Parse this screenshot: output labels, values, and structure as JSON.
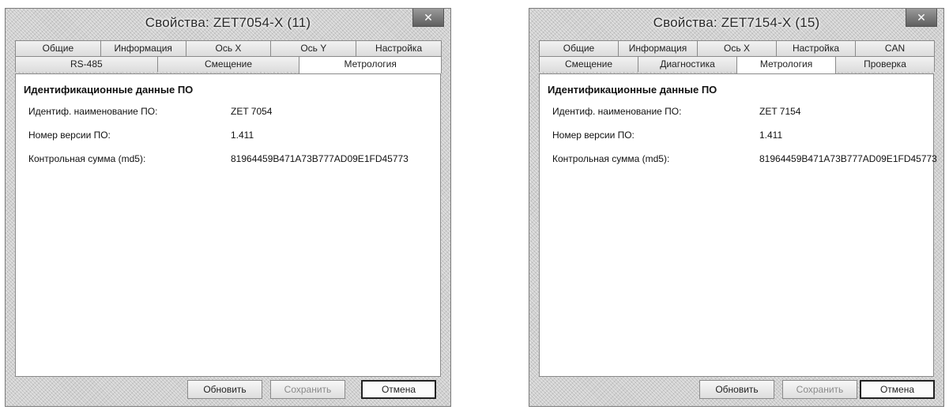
{
  "windows": [
    {
      "title": "Свойства: ZET7054-X (11)",
      "close_label": "✕",
      "tabs_row1": [
        "Общие",
        "Информация",
        "Ось X",
        "Ось Y",
        "Настройка"
      ],
      "tabs_row2": [
        "RS-485",
        "Смещение",
        "Метрология"
      ],
      "active_tab": "Метрология",
      "section_title": "Идентификационные данные ПО",
      "properties": [
        {
          "label": "Идентиф. наименование ПО:",
          "value": "ZET 7054"
        },
        {
          "label": "Номер версии ПО:",
          "value": "1.411"
        },
        {
          "label": "Контрольная сумма (md5):",
          "value": "81964459B471A73B777AD09E1FD45773"
        }
      ],
      "buttons": {
        "refresh": "Обновить",
        "save": "Сохранить",
        "cancel": "Отмена"
      }
    },
    {
      "title": "Свойства: ZET7154-X (15)",
      "close_label": "✕",
      "tabs_row1": [
        "Общие",
        "Информация",
        "Ось X",
        "Настройка",
        "CAN"
      ],
      "tabs_row2": [
        "Смещение",
        "Диагностика",
        "Метрология",
        "Проверка"
      ],
      "active_tab": "Метрология",
      "section_title": "Идентификационные данные ПО",
      "properties": [
        {
          "label": "Идентиф. наименование ПО:",
          "value": "ZET 7154"
        },
        {
          "label": "Номер версии ПО:",
          "value": "1.411"
        },
        {
          "label": "Контрольная сумма (md5):",
          "value": "81964459B471A73B777AD09E1FD45773"
        }
      ],
      "buttons": {
        "refresh": "Обновить",
        "save": "Сохранить",
        "cancel": "Отмена"
      }
    }
  ]
}
